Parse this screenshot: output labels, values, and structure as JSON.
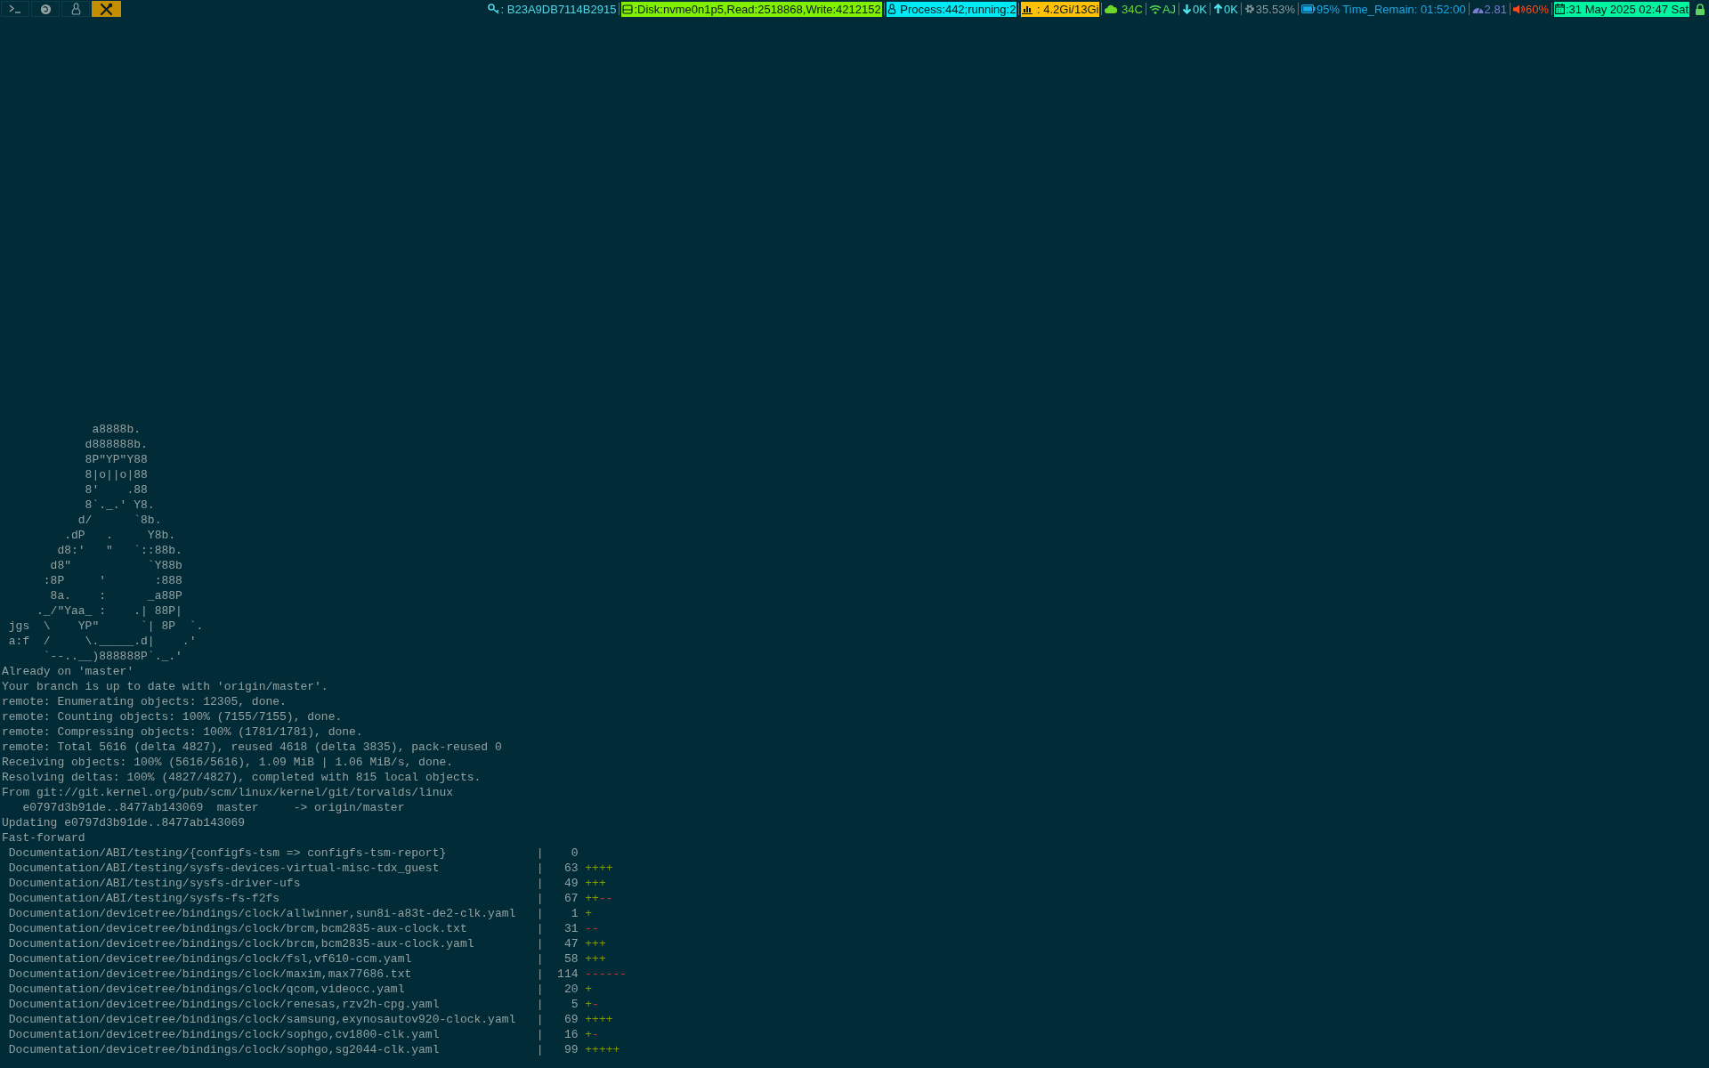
{
  "workspaces": [
    {
      "kind": "terminal",
      "selected": false
    },
    {
      "kind": "browser",
      "selected": false
    },
    {
      "kind": "linux",
      "selected": false
    },
    {
      "kind": "tools",
      "selected": true
    }
  ],
  "status_modules": [
    {
      "kind": "key",
      "text": ": B23A9DB7114B2915",
      "color": "#4fd6e6",
      "filled": false
    },
    {
      "kind": "disk",
      "text": ":Disk:nvme0n1p5,Read:2518868,Write:4212152",
      "color": "#80f000",
      "filled": true
    },
    {
      "kind": "process",
      "text": " Process:442;running:2",
      "color": "#00eaf5",
      "filled": true
    },
    {
      "kind": "memory",
      "text": " : 4.2Gi/13Gi",
      "color": "#ffc107",
      "filled": true
    },
    {
      "kind": "temperature",
      "text": " 34C",
      "color": "#6fd62a",
      "filled": false
    },
    {
      "kind": "wifi",
      "text": "AJ",
      "color": "#4fe04a",
      "filled": false
    },
    {
      "kind": "download",
      "text": "0K",
      "color": "#4fe6f0",
      "filled": false
    },
    {
      "kind": "upload",
      "text": "0K",
      "color": "#4fe6f0",
      "filled": false
    },
    {
      "kind": "cpu",
      "text": "35.53%",
      "color": "#8a9a9a",
      "filled": false
    },
    {
      "kind": "battery",
      "text": "95% Time_Remain: 01:52:00",
      "color": "#1aa8e8",
      "filled": false
    },
    {
      "kind": "load",
      "text": "2.81",
      "color": "#7b7bd0",
      "filled": false
    },
    {
      "kind": "volume",
      "text": "60%",
      "color": "#ff4a1a",
      "filled": false
    },
    {
      "kind": "date",
      "text": ":31 May 2025 02:47 Sat",
      "color": "#00f5a0",
      "filled": true
    }
  ],
  "terminal": {
    "ascii_art": [
      "             a8888b.",
      "            d888888b.",
      "            8P\"YP\"Y88",
      "            8|o||o|88",
      "            8'    .88",
      "            8`._.' Y8.",
      "           d/      `8b.",
      "         .dP   .     Y8b.",
      "        d8:'   \"   `::88b.",
      "       d8\"           `Y88b",
      "      :8P     '       :888",
      "       8a.    :      _a88P",
      "     ._/\"Yaa_ :    .| 88P|",
      " jgs  \\    YP\"      `| 8P  `.",
      " a:f  /     \\._____.d|    .'",
      "      `--..__)888888P`._.'"
    ],
    "output": [
      "Already on 'master'",
      "Your branch is up to date with 'origin/master'.",
      "remote: Enumerating objects: 12305, done.",
      "remote: Counting objects: 100% (7155/7155), done.",
      "remote: Compressing objects: 100% (1781/1781), done.",
      "remote: Total 5616 (delta 4827), reused 4618 (delta 3835), pack-reused 0",
      "Receiving objects: 100% (5616/5616), 1.09 MiB | 1.06 MiB/s, done.",
      "Resolving deltas: 100% (4827/4827), completed with 815 local objects.",
      "From git://git.kernel.org/pub/scm/linux/kernel/git/torvalds/linux",
      "   e0797d3b91de..8477ab143069  master     -> origin/master",
      "Updating e0797d3b91de..8477ab143069",
      "Fast-forward"
    ],
    "diffstat": [
      {
        "path": "Documentation/ABI/testing/{configfs-tsm => configfs-tsm-report}",
        "separator": "|",
        "count": "0"
      },
      {
        "path": "Documentation/ABI/testing/sysfs-devices-virtual-misc-tdx_guest",
        "separator": "|",
        "count": "63",
        "plus": "++++"
      },
      {
        "path": "Documentation/ABI/testing/sysfs-driver-ufs",
        "separator": "|",
        "count": "49",
        "plus": "+++"
      },
      {
        "path": "Documentation/ABI/testing/sysfs-fs-f2fs",
        "separator": "|",
        "count": "67",
        "plus": "++",
        "minus": "--"
      },
      {
        "path": "Documentation/devicetree/bindings/clock/allwinner,sun8i-a83t-de2-clk.yaml",
        "separator": "|",
        "count": "1",
        "plus": "+"
      },
      {
        "path": "Documentation/devicetree/bindings/clock/brcm,bcm2835-aux-clock.txt",
        "separator": "|",
        "count": "31",
        "minus": "--"
      },
      {
        "path": "Documentation/devicetree/bindings/clock/brcm,bcm2835-aux-clock.yaml",
        "separator": "|",
        "count": "47",
        "plus": "+++"
      },
      {
        "path": "Documentation/devicetree/bindings/clock/fsl,vf610-ccm.yaml",
        "separator": "|",
        "count": "58",
        "plus": "+++"
      },
      {
        "path": "Documentation/devicetree/bindings/clock/maxim,max77686.txt",
        "separator": "|",
        "count": "114",
        "minus": "------"
      },
      {
        "path": "Documentation/devicetree/bindings/clock/qcom,videocc.yaml",
        "separator": "|",
        "count": "20",
        "plus": "+"
      },
      {
        "path": "Documentation/devicetree/bindings/clock/renesas,rzv2h-cpg.yaml",
        "separator": "|",
        "count": "5",
        "plus": "+",
        "minus": "-"
      },
      {
        "path": "Documentation/devicetree/bindings/clock/samsung,exynosautov920-clock.yaml",
        "separator": "|",
        "count": "69",
        "plus": "++++"
      },
      {
        "path": "Documentation/devicetree/bindings/clock/sophgo,cv1800-clk.yaml",
        "separator": "|",
        "count": "16",
        "plus": "+",
        "minus": "-"
      },
      {
        "path": "Documentation/devicetree/bindings/clock/sophgo,sg2044-clk.yaml",
        "separator": "|",
        "count": "99",
        "plus": "+++++"
      }
    ]
  }
}
